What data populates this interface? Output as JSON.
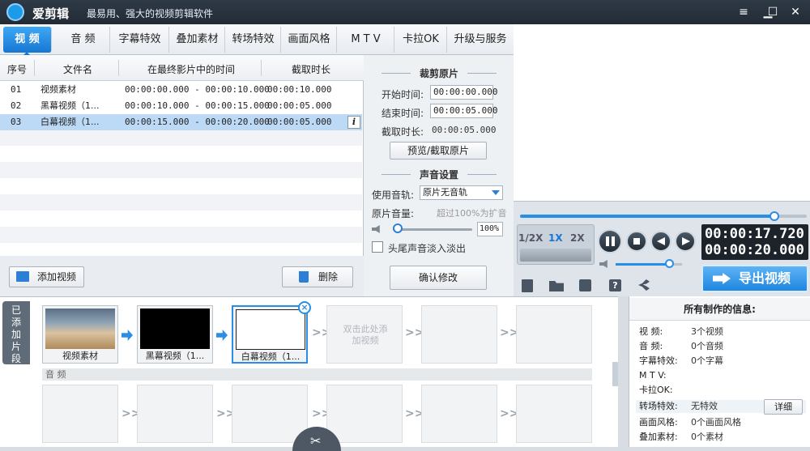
{
  "app": {
    "name": "爱剪辑",
    "slogan": "最易用、强大的视频剪辑软件"
  },
  "window_controls": {
    "menu": "≡",
    "minimize": "▁",
    "maximize": "☐",
    "close": "✕"
  },
  "tabs": [
    "视 频",
    "音 频",
    "字幕特效",
    "叠加素材",
    "转场特效",
    "画面风格",
    "M T V",
    "卡拉OK",
    "升级与服务"
  ],
  "active_tab": "视 频",
  "table": {
    "headers": [
      "序号",
      "文件名",
      "在最终影片中的时间",
      "截取时长"
    ],
    "rows": [
      {
        "no": "01",
        "name": "视频素材",
        "range": "00:00:00.000 - 00:00:10.000",
        "dur": "00:00:10.000"
      },
      {
        "no": "02",
        "name": "黑幕视频（1...",
        "range": "00:00:10.000 - 00:00:15.000",
        "dur": "00:00:05.000"
      },
      {
        "no": "03",
        "name": "白幕视频（1...",
        "range": "00:00:15.000 - 00:00:20.000",
        "dur": "00:00:05.000"
      }
    ],
    "selected_row": 2,
    "info_glyph": "i"
  },
  "list_buttons": {
    "add": "添加视频",
    "delete": "删除"
  },
  "cut": {
    "title": "裁剪原片",
    "start_label": "开始时间:",
    "start_value": "00:00:00.000",
    "end_label": "结束时间:",
    "end_value": "00:00:05.000",
    "dur_label": "截取时长:",
    "dur_value": "00:00:05.000",
    "preview_button": "预览/截取原片"
  },
  "audio": {
    "title": "声音设置",
    "track_label": "使用音轨:",
    "track_value": "原片无音轨",
    "volume_label": "原片音量:",
    "volume_hint": "超过100%为扩音",
    "volume_value": "100%",
    "fade_label": "头尾声音淡入淡出",
    "confirm_button": "确认修改"
  },
  "player": {
    "speeds": [
      "1/2X",
      "1X",
      "2X"
    ],
    "active_speed": "1X",
    "current_time": "00:00:17.720",
    "total_time": "00:00:20.000",
    "progress": 0.886,
    "volume": 0.8,
    "export_button": "导出视频"
  },
  "storyboard": {
    "side_label": "已添加片段",
    "clips": [
      "视频素材",
      "黑幕视频（1...",
      "白幕视频（1..."
    ],
    "placeholder": "双击此处添加视频",
    "audio_label": "音 频"
  },
  "info": {
    "title": "所有制作的信息:",
    "rows": [
      {
        "k": "视    频:",
        "v": "3个视频"
      },
      {
        "k": "音    频:",
        "v": "0个音频"
      },
      {
        "k": "字幕特效:",
        "v": "0个字幕"
      },
      {
        "k": "M T V:",
        "v": ""
      },
      {
        "k": "卡拉OK:",
        "v": ""
      },
      {
        "k": "转场特效:",
        "v": "无特效"
      },
      {
        "k": "画面风格:",
        "v": "0个画面风格"
      },
      {
        "k": "叠加素材:",
        "v": "0个素材"
      }
    ],
    "detail_button": "详细"
  },
  "colors": {
    "accent": "#1677d2",
    "titlebar": "#2a3440",
    "export": "#1f86e0"
  }
}
